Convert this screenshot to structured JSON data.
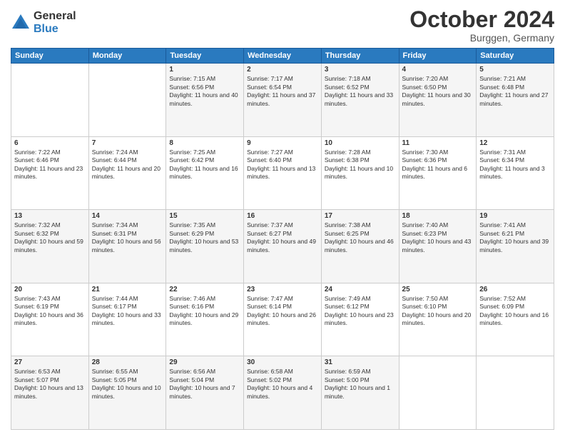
{
  "logo": {
    "general": "General",
    "blue": "Blue"
  },
  "header": {
    "month": "October 2024",
    "location": "Burggen, Germany"
  },
  "weekdays": [
    "Sunday",
    "Monday",
    "Tuesday",
    "Wednesday",
    "Thursday",
    "Friday",
    "Saturday"
  ],
  "weeks": [
    [
      {
        "day": "",
        "content": ""
      },
      {
        "day": "",
        "content": ""
      },
      {
        "day": "1",
        "content": "Sunrise: 7:15 AM\nSunset: 6:56 PM\nDaylight: 11 hours and 40 minutes."
      },
      {
        "day": "2",
        "content": "Sunrise: 7:17 AM\nSunset: 6:54 PM\nDaylight: 11 hours and 37 minutes."
      },
      {
        "day": "3",
        "content": "Sunrise: 7:18 AM\nSunset: 6:52 PM\nDaylight: 11 hours and 33 minutes."
      },
      {
        "day": "4",
        "content": "Sunrise: 7:20 AM\nSunset: 6:50 PM\nDaylight: 11 hours and 30 minutes."
      },
      {
        "day": "5",
        "content": "Sunrise: 7:21 AM\nSunset: 6:48 PM\nDaylight: 11 hours and 27 minutes."
      }
    ],
    [
      {
        "day": "6",
        "content": "Sunrise: 7:22 AM\nSunset: 6:46 PM\nDaylight: 11 hours and 23 minutes."
      },
      {
        "day": "7",
        "content": "Sunrise: 7:24 AM\nSunset: 6:44 PM\nDaylight: 11 hours and 20 minutes."
      },
      {
        "day": "8",
        "content": "Sunrise: 7:25 AM\nSunset: 6:42 PM\nDaylight: 11 hours and 16 minutes."
      },
      {
        "day": "9",
        "content": "Sunrise: 7:27 AM\nSunset: 6:40 PM\nDaylight: 11 hours and 13 minutes."
      },
      {
        "day": "10",
        "content": "Sunrise: 7:28 AM\nSunset: 6:38 PM\nDaylight: 11 hours and 10 minutes."
      },
      {
        "day": "11",
        "content": "Sunrise: 7:30 AM\nSunset: 6:36 PM\nDaylight: 11 hours and 6 minutes."
      },
      {
        "day": "12",
        "content": "Sunrise: 7:31 AM\nSunset: 6:34 PM\nDaylight: 11 hours and 3 minutes."
      }
    ],
    [
      {
        "day": "13",
        "content": "Sunrise: 7:32 AM\nSunset: 6:32 PM\nDaylight: 10 hours and 59 minutes."
      },
      {
        "day": "14",
        "content": "Sunrise: 7:34 AM\nSunset: 6:31 PM\nDaylight: 10 hours and 56 minutes."
      },
      {
        "day": "15",
        "content": "Sunrise: 7:35 AM\nSunset: 6:29 PM\nDaylight: 10 hours and 53 minutes."
      },
      {
        "day": "16",
        "content": "Sunrise: 7:37 AM\nSunset: 6:27 PM\nDaylight: 10 hours and 49 minutes."
      },
      {
        "day": "17",
        "content": "Sunrise: 7:38 AM\nSunset: 6:25 PM\nDaylight: 10 hours and 46 minutes."
      },
      {
        "day": "18",
        "content": "Sunrise: 7:40 AM\nSunset: 6:23 PM\nDaylight: 10 hours and 43 minutes."
      },
      {
        "day": "19",
        "content": "Sunrise: 7:41 AM\nSunset: 6:21 PM\nDaylight: 10 hours and 39 minutes."
      }
    ],
    [
      {
        "day": "20",
        "content": "Sunrise: 7:43 AM\nSunset: 6:19 PM\nDaylight: 10 hours and 36 minutes."
      },
      {
        "day": "21",
        "content": "Sunrise: 7:44 AM\nSunset: 6:17 PM\nDaylight: 10 hours and 33 minutes."
      },
      {
        "day": "22",
        "content": "Sunrise: 7:46 AM\nSunset: 6:16 PM\nDaylight: 10 hours and 29 minutes."
      },
      {
        "day": "23",
        "content": "Sunrise: 7:47 AM\nSunset: 6:14 PM\nDaylight: 10 hours and 26 minutes."
      },
      {
        "day": "24",
        "content": "Sunrise: 7:49 AM\nSunset: 6:12 PM\nDaylight: 10 hours and 23 minutes."
      },
      {
        "day": "25",
        "content": "Sunrise: 7:50 AM\nSunset: 6:10 PM\nDaylight: 10 hours and 20 minutes."
      },
      {
        "day": "26",
        "content": "Sunrise: 7:52 AM\nSunset: 6:09 PM\nDaylight: 10 hours and 16 minutes."
      }
    ],
    [
      {
        "day": "27",
        "content": "Sunrise: 6:53 AM\nSunset: 5:07 PM\nDaylight: 10 hours and 13 minutes."
      },
      {
        "day": "28",
        "content": "Sunrise: 6:55 AM\nSunset: 5:05 PM\nDaylight: 10 hours and 10 minutes."
      },
      {
        "day": "29",
        "content": "Sunrise: 6:56 AM\nSunset: 5:04 PM\nDaylight: 10 hours and 7 minutes."
      },
      {
        "day": "30",
        "content": "Sunrise: 6:58 AM\nSunset: 5:02 PM\nDaylight: 10 hours and 4 minutes."
      },
      {
        "day": "31",
        "content": "Sunrise: 6:59 AM\nSunset: 5:00 PM\nDaylight: 10 hours and 1 minute."
      },
      {
        "day": "",
        "content": ""
      },
      {
        "day": "",
        "content": ""
      }
    ]
  ]
}
